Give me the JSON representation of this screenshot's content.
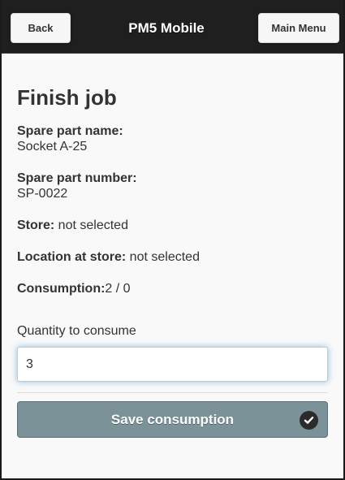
{
  "header": {
    "back_label": "Back",
    "title": "PM5 Mobile",
    "main_menu_label": "Main Menu"
  },
  "page": {
    "title": "Finish job"
  },
  "details": {
    "spare_part_name_label": "Spare part name:",
    "spare_part_name_value": "Socket A-25",
    "spare_part_number_label": "Spare part number:",
    "spare_part_number_value": "SP-0022",
    "store_label": "Store:",
    "store_value": " not selected",
    "location_label": "Location at store:",
    "location_value": " not selected",
    "consumption_label": "Consumption:",
    "consumption_value": "2 / 0"
  },
  "quantity": {
    "label": "Quantity to consume",
    "value": "3"
  },
  "actions": {
    "save_label": "Save consumption",
    "save_icon": "check-circle-icon"
  },
  "colors": {
    "header_bg": "#1f1f1f",
    "save_button_bg": "#7c9299",
    "focus_glow": "#388cc8"
  }
}
